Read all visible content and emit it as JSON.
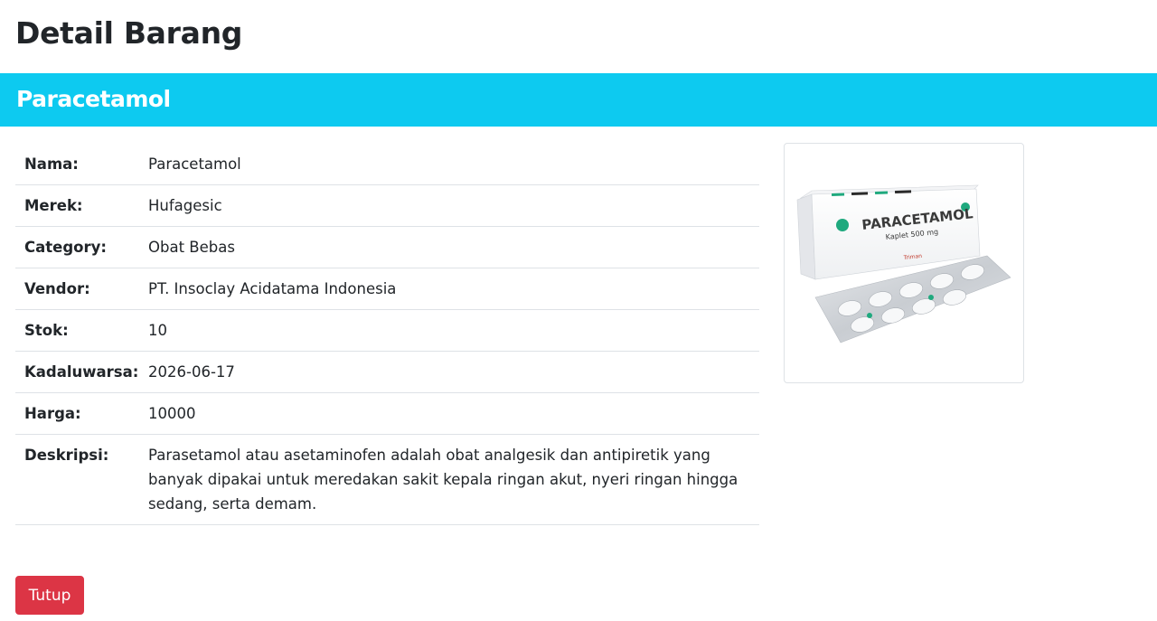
{
  "page": {
    "title": "Detail Barang"
  },
  "card": {
    "header_title": "Paracetamol",
    "header_color": "#0dcaf0"
  },
  "details": [
    {
      "label": "Nama:",
      "value": "Paracetamol"
    },
    {
      "label": "Merek:",
      "value": "Hufagesic"
    },
    {
      "label": "Category:",
      "value": "Obat Bebas"
    },
    {
      "label": "Vendor:",
      "value": "PT. Insoclay Acidatama Indonesia"
    },
    {
      "label": "Stok:",
      "value": "10"
    },
    {
      "label": "Kadaluwarsa:",
      "value": "2026-06-17"
    },
    {
      "label": "Harga:",
      "value": "10000"
    },
    {
      "label": "Deskripsi:",
      "value": "Parasetamol atau asetaminofen adalah obat analgesik dan antipiretik yang banyak dipakai untuk meredakan sakit kepala ringan akut, nyeri ringan hingga sedang, serta demam."
    }
  ],
  "product_image": {
    "brand_text": "PARACETAMOL",
    "dose_text": "Kaplet 500 mg",
    "maker_text": "Triman"
  },
  "actions": {
    "close_label": "Tutup",
    "close_color": "#dc3545"
  }
}
